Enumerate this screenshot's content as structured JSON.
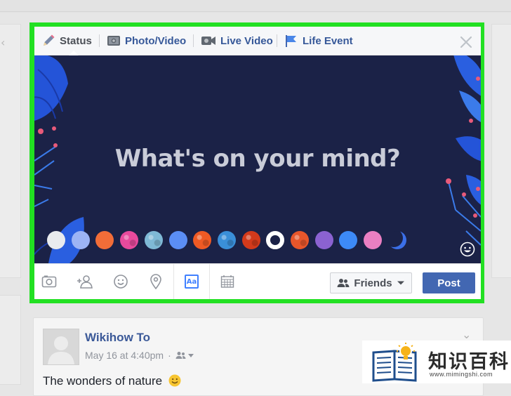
{
  "composer": {
    "tabs": [
      {
        "label": "Status",
        "icon": "pencil-icon",
        "active": true
      },
      {
        "label": "Photo/Video",
        "icon": "camera-icon",
        "active": false
      },
      {
        "label": "Live Video",
        "icon": "video-camera-icon",
        "active": false
      },
      {
        "label": "Life Event",
        "icon": "flag-icon",
        "active": false
      }
    ],
    "prompt": "What's on your mind?",
    "background_swatches": [
      {
        "color": "#e9ebee",
        "kind": "solid"
      },
      {
        "color": "#9cb4f5",
        "kind": "solid"
      },
      {
        "color": "#f26d38",
        "kind": "solid"
      },
      {
        "color": "#e84a9d",
        "kind": "pattern"
      },
      {
        "color": "#7fb9d6",
        "kind": "pattern"
      },
      {
        "color": "#5b8ef5",
        "kind": "solid"
      },
      {
        "color": "#ee5a24",
        "kind": "pattern"
      },
      {
        "color": "#3a8fd8",
        "kind": "pattern"
      },
      {
        "color": "#d33a1b",
        "kind": "pattern"
      },
      {
        "color": "#ffffff",
        "kind": "selected"
      },
      {
        "color": "#e8562b",
        "kind": "pattern"
      },
      {
        "color": "#8b62d1",
        "kind": "solid"
      },
      {
        "color": "#3d8af7",
        "kind": "solid"
      },
      {
        "color": "#ea7fc2",
        "kind": "solid"
      },
      {
        "color": "#1b2247",
        "kind": "moon"
      }
    ],
    "action_icons": [
      "photo-icon",
      "tag-friends-icon",
      "feeling-icon",
      "location-icon",
      "text-style-icon",
      "calendar-icon"
    ],
    "aa_label": "Aa",
    "audience_label": "Friends",
    "post_label": "Post",
    "colors": {
      "accent": "#4267b2",
      "link": "#365899",
      "canvas": "#1b2247",
      "highlight": "#22e022"
    }
  },
  "feed_post": {
    "author": "Wikihow To",
    "timestamp": "May 16 at 4:40pm",
    "separator": "·",
    "text": "The wonders of nature"
  },
  "watermark": {
    "title": "知识百科",
    "url": "www.mimingshi.com"
  }
}
